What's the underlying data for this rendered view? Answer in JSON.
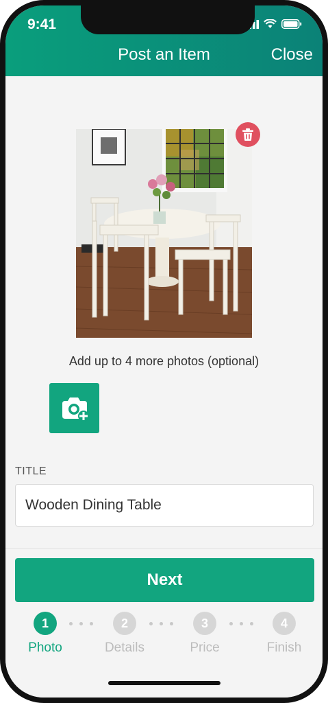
{
  "status_bar": {
    "time": "9:41"
  },
  "header": {
    "title": "Post an Item",
    "close_label": "Close"
  },
  "photos": {
    "add_more_text": "Add up to 4 more photos (optional)"
  },
  "form": {
    "title_label": "TITLE",
    "title_value": "Wooden Dining Table"
  },
  "footer": {
    "next_label": "Next"
  },
  "steps": [
    {
      "number": "1",
      "label": "Photo",
      "active": true
    },
    {
      "number": "2",
      "label": "Details",
      "active": false
    },
    {
      "number": "3",
      "label": "Price",
      "active": false
    },
    {
      "number": "4",
      "label": "Finish",
      "active": false
    }
  ],
  "colors": {
    "accent": "#12a57f",
    "header": "#0a9e7c",
    "delete": "#e0505f"
  },
  "icons": [
    "signal-icon",
    "wifi-icon",
    "battery-icon",
    "trash-icon",
    "add-photo-camera-icon"
  ]
}
